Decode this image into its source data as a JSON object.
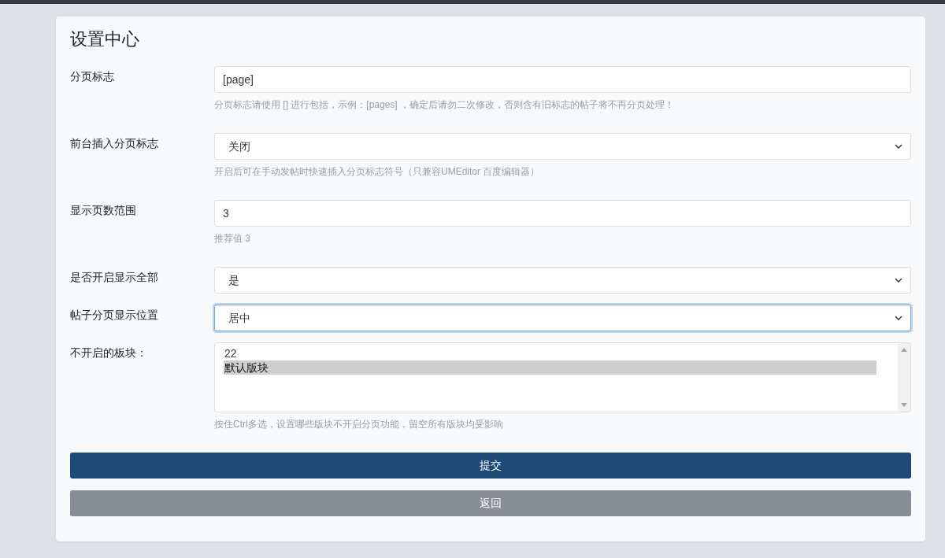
{
  "title": "设置中心",
  "fields": [
    {
      "kind": "text",
      "label": "分页标志",
      "value": "[page]",
      "help": "分页标志请使用 [] 进行包括，示例：[pages] ，确定后请勿二次修改，否则含有旧标志的帖子将不再分页处理！",
      "focused": false
    },
    {
      "kind": "select",
      "label": "前台插入分页标志",
      "value": "关闭",
      "help": "开启后可在手动发帖时快速插入分页标志符号（只兼容UMEditor 百度编辑器）",
      "focused": false
    },
    {
      "kind": "text",
      "label": "显示页数范围",
      "value": "3",
      "help": "推荐值 3",
      "focused": false
    },
    {
      "kind": "select",
      "label": "是否开启显示全部",
      "value": "是",
      "focused": false
    },
    {
      "kind": "select",
      "label": "帖子分页显示位置",
      "value": "居中",
      "focused": true
    },
    {
      "kind": "multiselect",
      "label": "不开启的板块：",
      "options": [
        {
          "label": "22",
          "selected": false
        },
        {
          "label": "默认版块",
          "selected": true
        }
      ],
      "help": "按住Ctrl多选，设置哪些版块不开启分页功能，留空所有版块均受影响",
      "focused": false
    }
  ],
  "buttons": [
    {
      "label": "提交",
      "kind": "primary"
    },
    {
      "label": "返回",
      "kind": "secondary"
    }
  ]
}
